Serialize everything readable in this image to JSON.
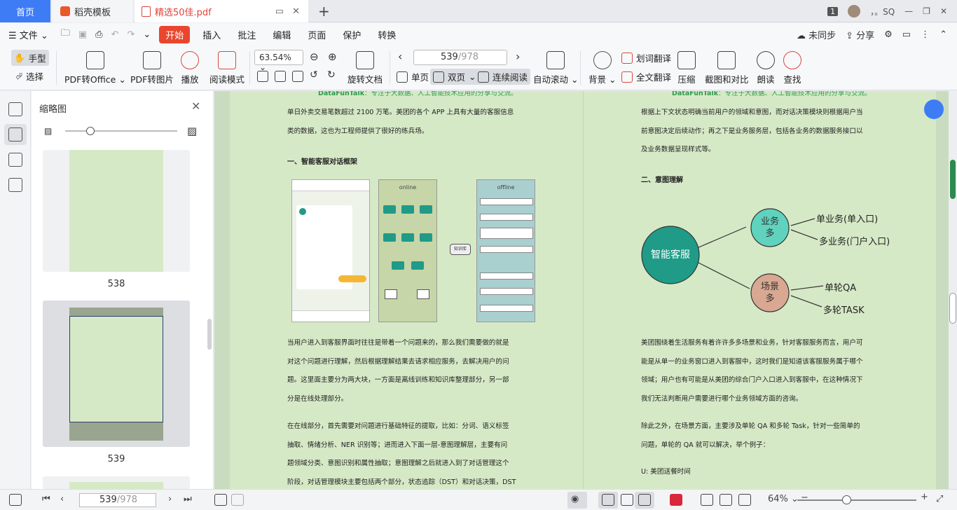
{
  "tabs": {
    "home": "首页",
    "template": "稻壳模板",
    "pdf": "精选50佳.pdf"
  },
  "window": {
    "badge": "1",
    "user": "，。SQ"
  },
  "menu": {
    "file": "文件",
    "items": [
      "开始",
      "插入",
      "批注",
      "编辑",
      "页面",
      "保护",
      "转换"
    ],
    "sync": "未同步",
    "share": "分享"
  },
  "ribbon": {
    "hand": "手型",
    "select": "选择",
    "pdf_office": "PDF转Office",
    "pdf_image": "PDF转图片",
    "play": "播放",
    "read_mode": "阅读模式",
    "zoom": "63.54%",
    "rotate": "旋转文档",
    "page_current": "539",
    "page_total": "/978",
    "single": "单页",
    "double": "双页",
    "continuous": "连续阅读",
    "auto_scroll": "自动滚动",
    "background": "背景",
    "word_translate": "划词翻译",
    "full_translate": "全文翻译",
    "compress": "压缩",
    "screenshot": "截图和对比",
    "read_aloud": "朗读",
    "find": "查找"
  },
  "thumbs": {
    "title": "缩略图",
    "pages": [
      "538",
      "539"
    ]
  },
  "doc": {
    "header_left": {
      "brand": "DataFunTalk",
      "rest": "：专注于大数据、人工智能技术应用的分享与交流。"
    },
    "header_right": {
      "brand": "DataFunTalk",
      "rest": "：专注于大数据、人工智能技术应用的分享与交流。"
    },
    "left_lines_1": [
      "单日外卖交易笔数超过 2100 万笔。美团的各个 APP 上具有大量的客服信息",
      "类的数据，这也为工程师提供了很好的练兵场。"
    ],
    "left_heading": "一、智能客服对话框架",
    "fig_online": "online",
    "fig_offline": "offline",
    "fig_kb": "知识库",
    "left_lines_2": [
      "当用户进入到客服界面时往往是带着一个问题来的，那么我们需要做的就是",
      "对这个问题进行理解，然后根据理解结果去请求相应服务，去解决用户的问",
      "题。这里面主要分为两大块，一方面是离线训练和知识库整理部分，另一部",
      "分是在线处理部分。"
    ],
    "left_lines_3": [
      "在在线部分，首先需要对问题进行基础特征的提取，比如：分词、语义标签",
      "抽取、情绪分析、NER 识别等；进而进入下面一层-意图理解层，主要有问",
      "题领域分类、意图识别和属性抽取；意图理解之后就进入到了对话管理这个",
      "阶段，对话管理模块主要包括两个部分，状态追踪（DST）和对话决策，DST"
    ],
    "right_lines_1": [
      "根据上下文状态明确当前用户的领域和意图，而对话决策模块则根据用户当",
      "前意图决定后续动作；再之下是业务服务层，包括各业务的数据服务接口以",
      "及业务数据呈现样式等。"
    ],
    "right_heading": "二、意图理解",
    "diagram": {
      "center": "智能客服",
      "node_top": "业务多",
      "node_bottom": "场景多",
      "leaf1": "单业务(单入口)",
      "leaf2": "多业务(门户入口)",
      "leaf3": "单轮QA",
      "leaf4": "多轮TASK"
    },
    "right_lines_2": [
      "美团围绕着生活服务有着许许多多场景和业务，针对客服服务而言，用户可",
      "能是从单一的业务窗口进入到客服中，这时我们是知道该客服服务属于哪个",
      "领域；用户也有可能是从美团的综合门户入口进入到客服中，在这种情况下",
      "我们无法判断用户需要进行哪个业务领域方面的咨询。"
    ],
    "right_lines_3": [
      "除此之外，在场景方面，主要涉及单轮 QA 和多轮 Task，针对一些简单的",
      "问题，单轮的 QA 就可以解决，举个例子："
    ],
    "right_example": "U: 美团送餐时间"
  },
  "status": {
    "page_current": "539",
    "page_total": "/978",
    "zoom": "64%"
  },
  "colors": {
    "accent": "#3d7cf5",
    "start_button": "#e9462d",
    "page_bg": "#d6e9c6",
    "node_teal": "#1f9b88",
    "node_brown": "#d9a892"
  }
}
